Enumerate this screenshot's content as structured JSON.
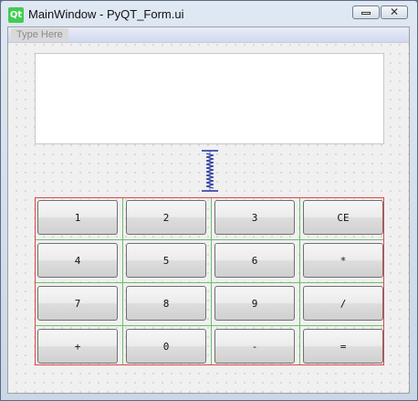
{
  "window": {
    "logo_text": "Qt",
    "title": "MainWindow - PyQT_Form.ui"
  },
  "menubar": {
    "placeholder": "Type Here"
  },
  "keypad": {
    "rows": [
      [
        "1",
        "2",
        "3",
        "CE"
      ],
      [
        "4",
        "5",
        "6",
        "*"
      ],
      [
        "7",
        "8",
        "9",
        "/"
      ],
      [
        "+",
        "0",
        "-",
        "="
      ]
    ]
  },
  "colors": {
    "layout_border": "#e04646",
    "layout_gridlines": "#6bbf6b",
    "spacer": "#1f2f9a",
    "qt_logo": "#41cd52"
  },
  "icons": {
    "app": "qt-logo-icon",
    "minimize": "minimize-icon",
    "close": "close-icon",
    "spacer": "vertical-spacer-icon"
  }
}
